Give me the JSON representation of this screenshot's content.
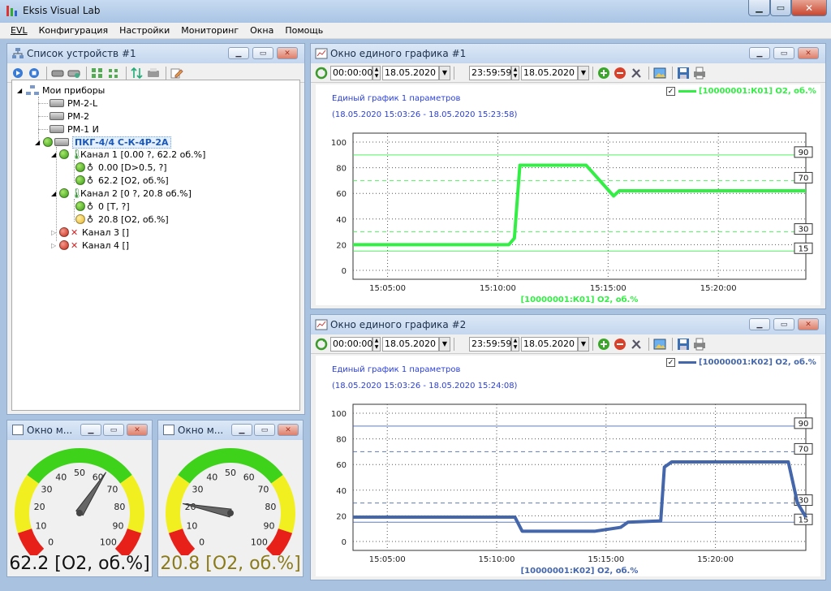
{
  "window": {
    "title": "Eksis Visual Lab"
  },
  "menu": [
    "EVL",
    "Конфигурация",
    "Настройки",
    "Мониторинг",
    "Окна",
    "Помощь"
  ],
  "device_panel": {
    "title": "Список устройств #1",
    "tree": [
      {
        "label": "Мои приборы",
        "level": 0
      },
      {
        "label": "РМ-2-L",
        "level": 1
      },
      {
        "label": "РМ-2",
        "level": 1
      },
      {
        "label": "РМ-1 И",
        "level": 1
      },
      {
        "label": "ПКГ-4/4 С-К-4Р-2А",
        "level": 1
      },
      {
        "label": "Канал 1 [0.00 ?, 62.2 об.%]",
        "level": 2
      },
      {
        "label": "0.00 [D>0.5, ?]",
        "level": 3
      },
      {
        "label": "62.2 [O2, об.%]",
        "level": 3
      },
      {
        "label": "Канал 2 [0 ?, 20.8 об.%]",
        "level": 2
      },
      {
        "label": "0 [T, ?]",
        "level": 3
      },
      {
        "label": "20.8 [O2, об.%]",
        "level": 3
      },
      {
        "label": "Канал 3 []",
        "level": 2
      },
      {
        "label": "Канал 4 []",
        "level": 2
      }
    ]
  },
  "gauges": [
    {
      "title": "Окно м...",
      "value": 62.2,
      "value_text": "62.2 [O2, об.%]",
      "ticks": [
        "0",
        "10",
        "20",
        "30",
        "40",
        "50",
        "60",
        "70",
        "80",
        "90",
        "100"
      ],
      "value_color": "#111111"
    },
    {
      "title": "Окно м...",
      "value": 20.8,
      "value_text": "20.8 [O2, об.%]",
      "ticks": [
        "0",
        "10",
        "20",
        "30",
        "40",
        "50",
        "60",
        "70",
        "80",
        "90",
        "100"
      ],
      "value_color": "#8a7a1a"
    }
  ],
  "charts": [
    {
      "title": "Окно единого графика #1",
      "time_from": "00:00:00",
      "date_from": "18.05.2020",
      "time_to": "23:59:59",
      "date_to": "18.05.2020",
      "subtitle": "Единый график 1 параметров",
      "range": "(18.05.2020 15:03:26 - 18.05.2020 15:23:58)",
      "legend": "[10000001:К01] O2, об.%",
      "color": "#33ee44",
      "threshold_labels": [
        "90",
        "70",
        "30",
        "15"
      ]
    },
    {
      "title": "Окно единого графика #2",
      "time_from": "00:00:00",
      "date_from": "18.05.2020",
      "time_to": "23:59:59",
      "date_to": "18.05.2020",
      "subtitle": "Единый график 1 параметров",
      "range": "(18.05.2020 15:03:26 - 18.05.2020 15:24:08)",
      "legend": "[10000001:К02] O2, об.%",
      "color": "#4466aa",
      "threshold_labels": [
        "90",
        "70",
        "30",
        "15"
      ]
    }
  ],
  "chart_data": [
    {
      "type": "line",
      "title": "Единый график 1 параметров",
      "xlabel": "[10000001:К01] O2, об.%",
      "x_ticks": [
        "15:05:00",
        "15:10:00",
        "15:15:00",
        "15:20:00"
      ],
      "y_ticks": [
        "0",
        "20",
        "40",
        "60",
        "80",
        "100"
      ],
      "ylim": [
        -7,
        107
      ],
      "xlim": [
        "15:03:26",
        "15:23:58"
      ],
      "thresholds": [
        {
          "value": 90,
          "style": "solid"
        },
        {
          "value": 70,
          "style": "dashed"
        },
        {
          "value": 30,
          "style": "dashed"
        },
        {
          "value": 15,
          "style": "solid"
        }
      ],
      "series": [
        {
          "name": "[10000001:К01] O2, об.%",
          "x": [
            "15:03:26",
            "15:10:30",
            "15:10:45",
            "15:11:00",
            "15:14:00",
            "15:15:15",
            "15:15:30",
            "15:23:58"
          ],
          "values": [
            20,
            20,
            25,
            82,
            82,
            58,
            62,
            62
          ]
        }
      ]
    },
    {
      "type": "line",
      "title": "Единый график 1 параметров",
      "xlabel": "[10000001:К02] O2, об.%",
      "x_ticks": [
        "15:05:00",
        "15:10:00",
        "15:15:00",
        "15:20:00"
      ],
      "y_ticks": [
        "0",
        "20",
        "40",
        "60",
        "80",
        "100"
      ],
      "ylim": [
        -7,
        107
      ],
      "xlim": [
        "15:03:26",
        "15:24:08"
      ],
      "thresholds": [
        {
          "value": 90,
          "style": "solid"
        },
        {
          "value": 70,
          "style": "dashed"
        },
        {
          "value": 30,
          "style": "dashed"
        },
        {
          "value": 15,
          "style": "solid"
        }
      ],
      "series": [
        {
          "name": "[10000001:К02] O2, об.%",
          "x": [
            "15:03:26",
            "15:10:50",
            "15:11:10",
            "15:14:30",
            "15:15:40",
            "15:16:00",
            "15:17:30",
            "15:17:40",
            "15:18:00",
            "15:23:20",
            "15:23:45",
            "15:24:08"
          ],
          "values": [
            19,
            19,
            8,
            8,
            11,
            15,
            16,
            58,
            62,
            62,
            30,
            19
          ]
        }
      ]
    }
  ]
}
